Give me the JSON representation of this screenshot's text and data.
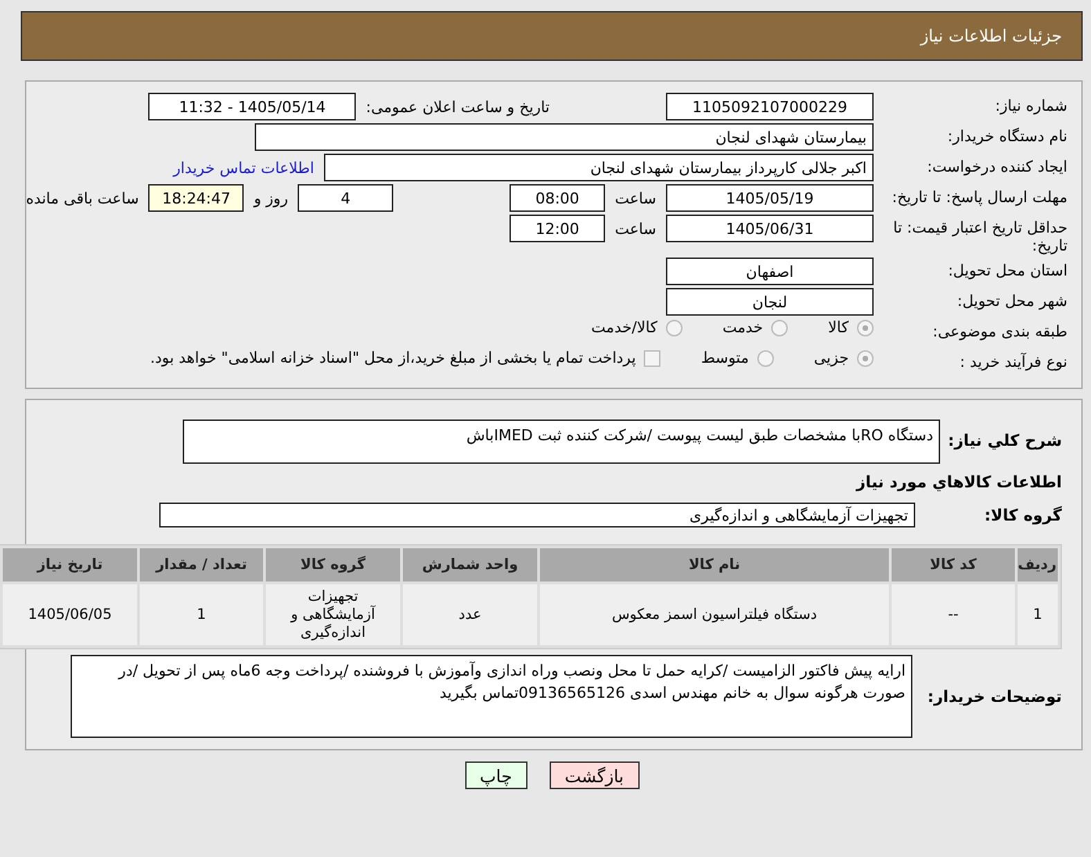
{
  "header": {
    "title": "جزئیات اطلاعات نیاز"
  },
  "rows": [
    {
      "label": "شماره نیاز:",
      "items": [
        {
          "kind": "field",
          "value": "1105092107000229"
        },
        {
          "kind": "gap"
        },
        {
          "kind": "text",
          "text": "تاریخ و ساعت اعلان عمومی:"
        },
        {
          "kind": "field",
          "value": "1405/05/14 - 11:32"
        }
      ]
    },
    {
      "label": "نام دستگاه خریدار:",
      "items": [
        {
          "kind": "long-field",
          "value": "بیمارستان شهدای لنجان"
        }
      ]
    },
    {
      "label": "ایجاد کننده درخواست:",
      "items": [
        {
          "kind": "wide-field",
          "value": "اکبر جلالی کارپرداز بیمارستان شهدای لنجان"
        },
        {
          "kind": "link",
          "text": "اطلاعات تماس خریدار"
        }
      ]
    },
    {
      "label": "مهلت ارسال پاسخ: تا تاریخ:",
      "items": [
        {
          "kind": "field",
          "value": "1405/05/19"
        },
        {
          "kind": "text",
          "text": "ساعت"
        },
        {
          "kind": "small-field",
          "value": "08:00"
        },
        {
          "kind": "gap"
        },
        {
          "kind": "small-field",
          "value": "4"
        },
        {
          "kind": "text",
          "text": "روز و"
        },
        {
          "kind": "countdown",
          "value": "18:24:47"
        },
        {
          "kind": "text",
          "text": "ساعت باقی مانده"
        }
      ]
    },
    {
      "label": "حداقل تاریخ اعتبار قیمت: تا تاریخ:",
      "items": [
        {
          "kind": "field",
          "value": "1405/06/31"
        },
        {
          "kind": "text",
          "text": "ساعت"
        },
        {
          "kind": "small-field",
          "value": "12:00"
        }
      ]
    },
    {
      "label": "استان محل تحویل:",
      "items": [
        {
          "kind": "field",
          "value": "اصفهان"
        }
      ]
    },
    {
      "label": "شهر محل تحویل:",
      "items": [
        {
          "kind": "field",
          "value": "لنجان"
        }
      ]
    },
    {
      "label": "طبقه بندی موضوعی:",
      "items": [
        {
          "kind": "radio",
          "text": "کالا",
          "selected": true
        },
        {
          "kind": "radio",
          "text": "خدمت",
          "selected": false
        },
        {
          "kind": "radio",
          "text": "کالا/خدمت",
          "selected": false
        }
      ]
    },
    {
      "label": "نوع فرآیند خرید :",
      "items": [
        {
          "kind": "radio",
          "text": "جزیی",
          "selected": true
        },
        {
          "kind": "radio",
          "text": "متوسط",
          "selected": false
        },
        {
          "kind": "checkbox",
          "text": "پرداخت تمام یا بخشی از مبلغ خرید،از محل \"اسناد خزانه اسلامی\" خواهد بود.",
          "checked": false
        }
      ]
    }
  ],
  "description": {
    "label": "شرح کلي نیاز:",
    "value": "دستگاه ROبا مشخصات طبق لیست پیوست /شرکت کننده ثبت IMEDباش"
  },
  "goods_heading": "اطلاعات کالاهاي مورد نیاز",
  "goods_group": {
    "label": "گروه کالا:",
    "value": "تجهیزات آزمایشگاهی و اندازه‌گیری"
  },
  "table": {
    "columns": [
      "ردیف",
      "کد کالا",
      "نام کالا",
      "واحد شمارش",
      "گروه کالا",
      "تعداد / مقدار",
      "تاریخ نیاز"
    ],
    "rows": [
      [
        "1",
        "--",
        "دستگاه فیلتراسیون اسمز معکوس",
        "عدد",
        "تجهیزات آزمایشگاهی و اندازه‌گیری",
        "1",
        "1405/06/05"
      ]
    ]
  },
  "buyer_notes": {
    "label": "توضیحات خریدار:",
    "value": "ارایه پیش فاکتور الزامیست /کرایه حمل تا محل ونصب وراه اندازی وآموزش با فروشنده /پرداخت وجه 6ماه پس از تحویل /در صورت هرگونه سوال به خانم مهندس اسدی 09136565126تماس بگیرید"
  },
  "buttons": [
    {
      "kind": "back",
      "label": "بازگشت"
    },
    {
      "kind": "print",
      "label": "چاپ"
    }
  ]
}
